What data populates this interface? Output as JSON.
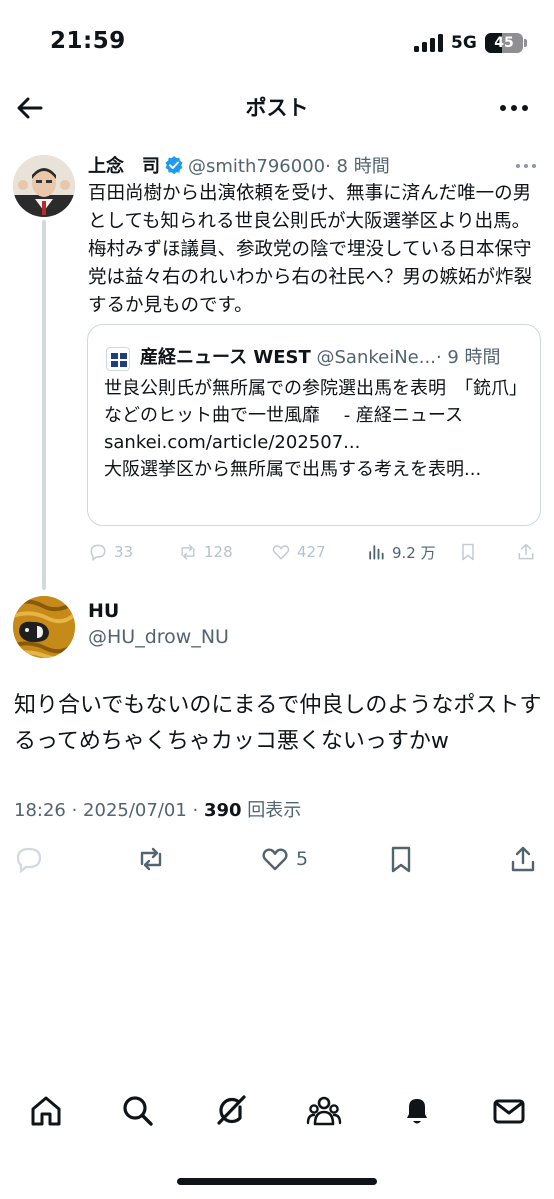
{
  "status_bar": {
    "time": "21:59",
    "network": "5G",
    "battery": "45"
  },
  "nav": {
    "title": "ポスト",
    "back_icon": "arrow-left-icon",
    "more_icon": "ellipsis-icon"
  },
  "original_post": {
    "display_name": "上念　司",
    "handle": "@smith796000",
    "time_ago": "· 8 時間",
    "text": "百田尚樹から出演依頼を受け、無事に済んだ唯一の男としても知られる世良公則氏が大阪選挙区より出馬。梅村みずほ議員、参政党の陰で埋没している日本保守党は益々右のれいわから右の社民へ？男の嫉妬が炸裂するか見ものです。",
    "quote": {
      "display_name": "産経ニュース WEST",
      "handle": "@SankeiNe...",
      "time_ago": "· 9 時間",
      "text": "世良公則氏が無所属での参院選出馬を表明　「銃爪」などのヒット曲で一世風靡　 - 産経ニュース\nsankei.com/article/202507...\n大阪選挙区から無所属で出馬する考えを表明..."
    },
    "actions": {
      "replies": "33",
      "reposts": "128",
      "likes": "427",
      "views": "9.2 万"
    }
  },
  "reply_post": {
    "display_name": "HU",
    "handle": "@HU_drow_NU",
    "text": "知り合いでもないのにまるで仲良しのようなポストするってめちゃくちゃカッコ悪くないっすかw",
    "timestamp": "18:26 · 2025/07/01 · ",
    "view_count": "390",
    "view_label": " 回表示",
    "likes": "5"
  },
  "tab_bar": [
    "home-icon",
    "search-icon",
    "grok-icon",
    "communities-icon",
    "notifications-icon",
    "messages-icon"
  ],
  "colors": {
    "text": "#0f1419",
    "secondary": "#536471",
    "border": "#cfd9de",
    "verified": "#1d9bf0"
  }
}
